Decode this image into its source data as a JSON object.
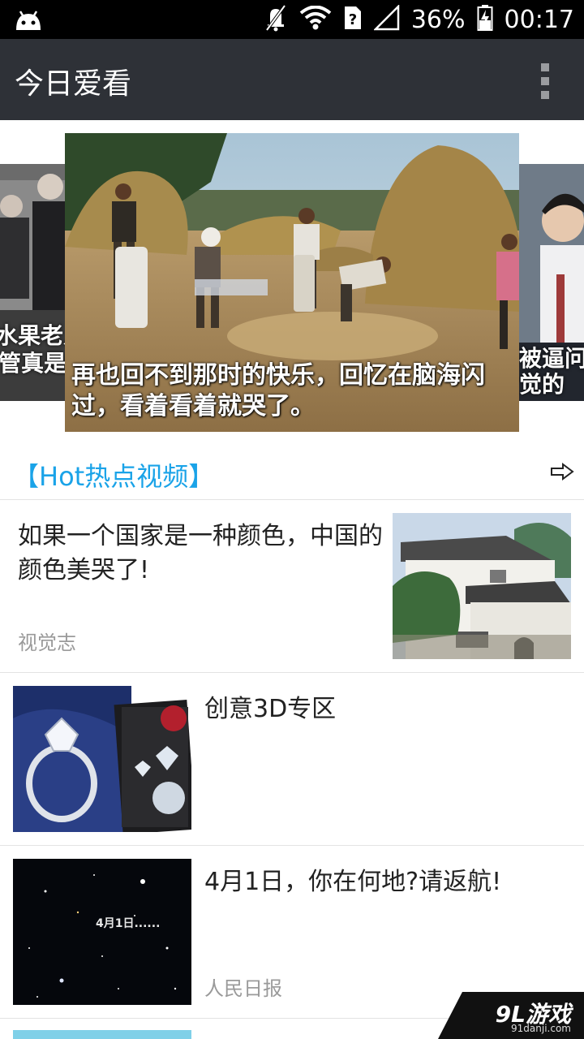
{
  "status_bar": {
    "battery": "36%",
    "time": "00:17"
  },
  "app": {
    "title": "今日爱看"
  },
  "carousel": {
    "left_caption_line1": "水果老人",
    "left_caption_line2": "管真是无",
    "main_caption": "再也回不到那时的快乐，回忆在脑海闪过，看着看着就哭了。",
    "right_caption_line1": "被逼问苦",
    "right_caption_line2": "觉的"
  },
  "section": {
    "title": "【Hot热点视频】"
  },
  "articles": [
    {
      "title": "如果一个国家是一种颜色，中国的颜色美哭了!",
      "source": "视觉志"
    },
    {
      "title": "创意3D专区",
      "source": ""
    },
    {
      "title": "4月1日，你在何地?请返航!",
      "source": "人民日报",
      "thumb_text": "4月1日......"
    }
  ],
  "watermark": {
    "logo": "9L游戏",
    "domain": "91danji.com"
  },
  "icons": {
    "status": [
      "android-icon",
      "mute-icon",
      "wifi-icon",
      "sim-unknown-icon",
      "signal-icon",
      "battery-charging-icon"
    ],
    "menu": "overflow-menu-icon",
    "section_more": "arrow-right-icon"
  },
  "colors": {
    "status_bar": "#000000",
    "action_bar": "#2e3137",
    "accent": "#1aa3e8"
  }
}
